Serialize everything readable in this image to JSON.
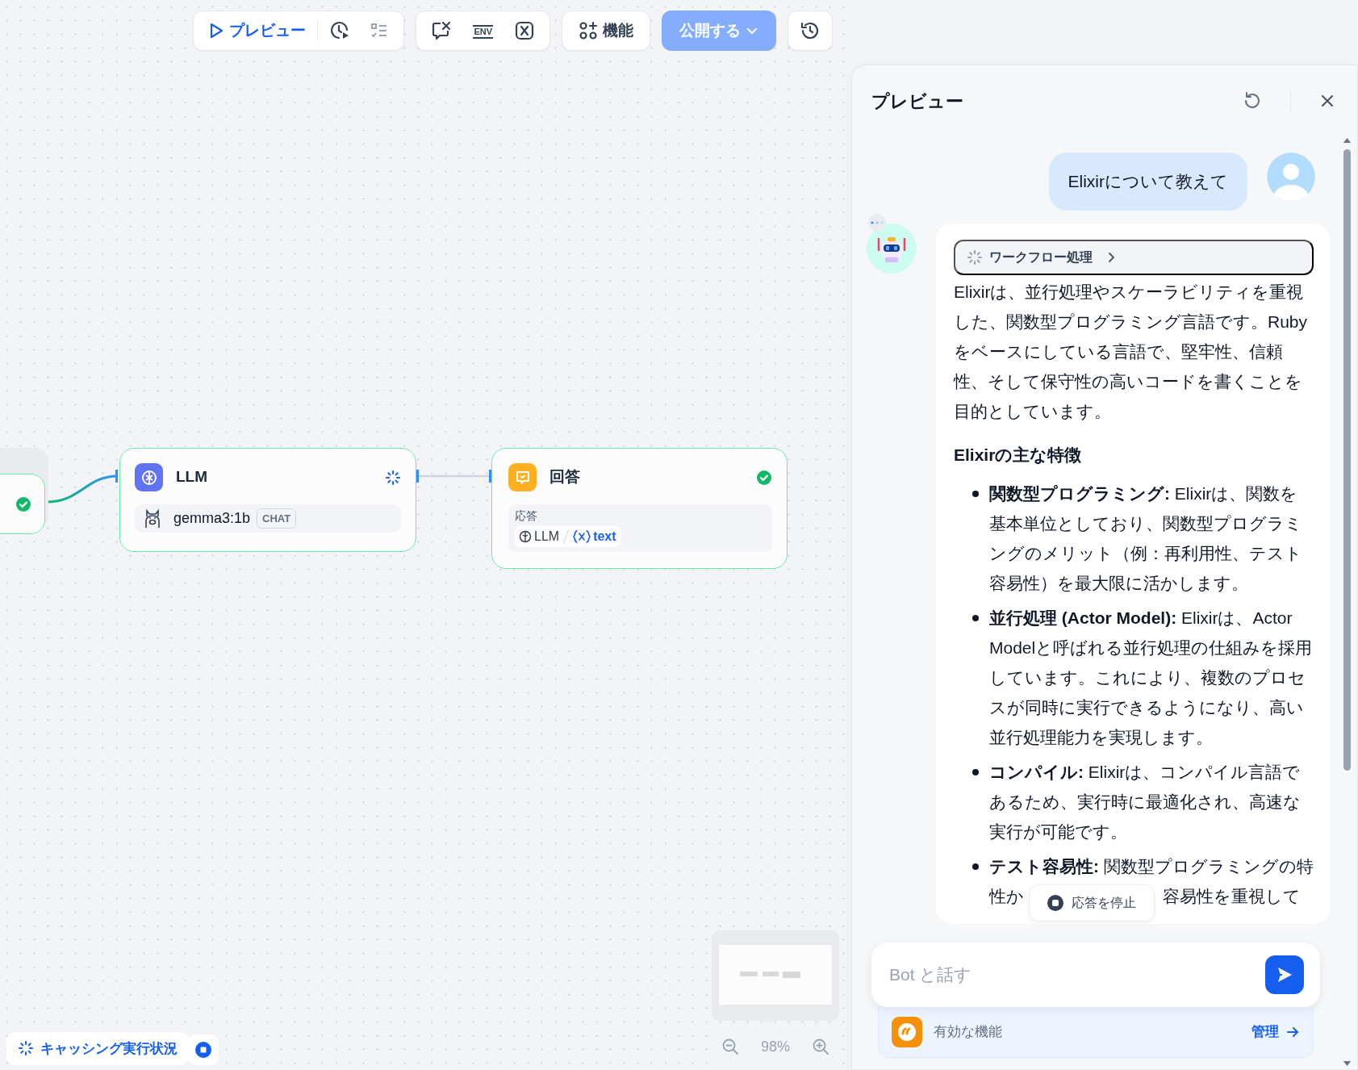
{
  "toolbar": {
    "preview_button": "プレビュー",
    "env_button": "ENV",
    "features_button": "機能",
    "publish_button": {
      "label": "公開する",
      "disabled": true
    }
  },
  "canvas": {
    "nodes": [
      {
        "kind": "partial",
        "running": false
      },
      {
        "kind": "llm",
        "title": "LLM",
        "running": true,
        "model": "gemma3:1b",
        "model_tag": "CHAT"
      },
      {
        "kind": "answer",
        "title": "回答",
        "running": false,
        "field_label": "応答",
        "source": "LLM",
        "variable": "text"
      }
    ],
    "run_status": "キャッシング実行状況",
    "zoom": "98%"
  },
  "preview": {
    "title": "プレビュー",
    "messages": [
      {
        "kind": "user",
        "text": "Elixirについて教えて"
      },
      {
        "kind": "bot",
        "typing": true,
        "workflow": {
          "label": "ワークフロー処理",
          "running": true
        },
        "blocks": [
          {
            "kind": "paragraph",
            "text": "Elixirは、並行処理やスケーラビリティを重視した、関数型プログラミング言語です。Rubyをベースにしている言語で、堅牢性、信頼性、そして保守性の高いコードを書くことを目的としています。"
          },
          {
            "kind": "heading",
            "text": "Elixirの主な特徴"
          },
          {
            "kind": "list",
            "items": [
              {
                "text": "**関数型プログラミング:** Elixirは、関数を基本単位としており、関数型プログラミングのメリット（例：再利用性、テスト容易性）を最大限に活かします。"
              },
              {
                "text": "**並行処理 (Actor Model):** Elixirは、Actor Modelと呼ばれる並行処理の仕組みを採用しています。これにより、複数のプロセスが同時に実行できるようになり、高い並行処理能力を実現します。"
              },
              {
                "text": "**コンパイル:** Elixirは、コンパイル言語であるため、実行時に最適化され、高速な実行が可能です。"
              },
              {
                "lines": [
                  "**テスト容易性:** 関数型プログラミングの特",
                  "性か",
                  "容易性を重視して"
                ]
              }
            ]
          }
        ]
      }
    ],
    "stop_button": "応答を停止",
    "input": {
      "placeholder": "Bot と話す"
    },
    "features": {
      "label": "有効な機能",
      "manage_link": "管理"
    }
  }
}
